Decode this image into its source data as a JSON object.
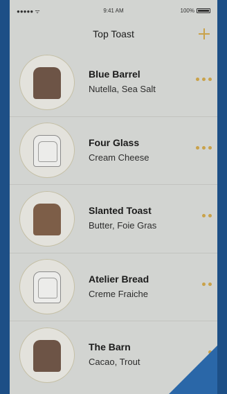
{
  "status_bar": {
    "signal": "●●●●● ᯤ",
    "time": "9:41 AM",
    "battery": "100%"
  },
  "nav": {
    "title": "Top Toast",
    "add_icon": "plus-icon"
  },
  "accent_color": "#c9a24a",
  "items": [
    {
      "name": "Blue Barrel",
      "topping": "Nutella, Sea Salt",
      "rating": 3,
      "toast": "dark"
    },
    {
      "name": "Four Glass",
      "topping": "Cream Cheese",
      "rating": 3,
      "toast": "light"
    },
    {
      "name": "Slanted Toast",
      "topping": "Butter, Foie Gras",
      "rating": 2,
      "toast": "medium"
    },
    {
      "name": "Atelier Bread",
      "topping": "Creme Fraiche",
      "rating": 2,
      "toast": "light"
    },
    {
      "name": "The Barn",
      "topping": "Cacao, Trout",
      "rating": 1,
      "toast": "dark"
    }
  ]
}
